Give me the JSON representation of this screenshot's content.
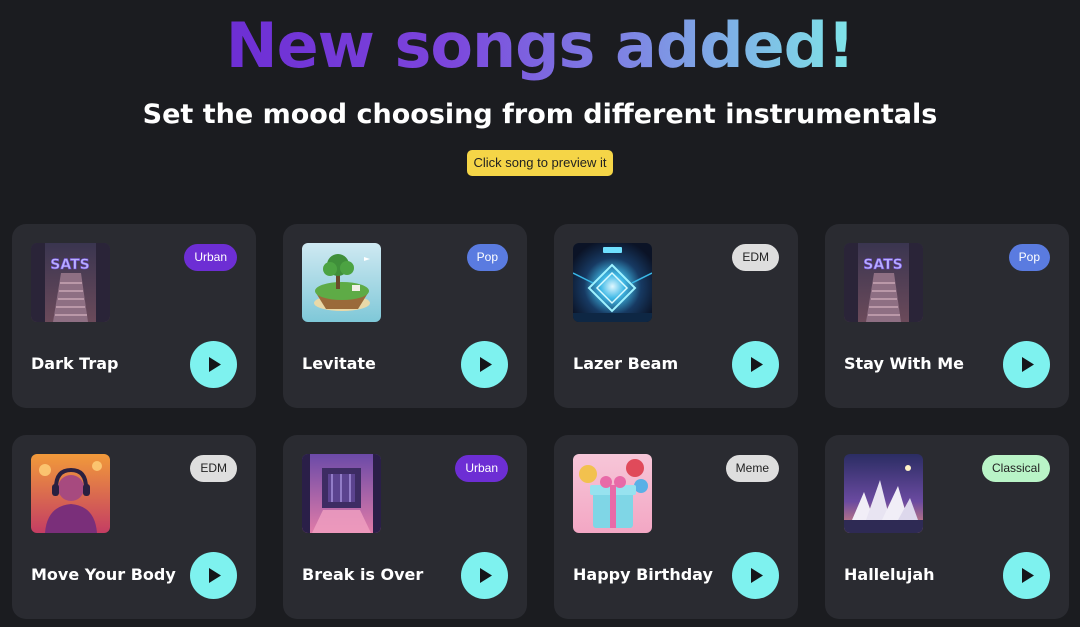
{
  "header": {
    "headline": "New songs added!",
    "subtitle": "Set the mood choosing from different instrumentals",
    "hint": "Click song to preview it"
  },
  "colors": {
    "background": "#1b1c20",
    "card": "#2a2b31",
    "play_button": "#7ef2ef",
    "hint": "#f5d547",
    "headline_gradient": [
      "#6d2ed4",
      "#7e87e4",
      "#7fe6e8"
    ]
  },
  "songs": [
    {
      "title": "Dark Trap",
      "genre": "Urban",
      "genre_color": "#6d2ed4",
      "genre_text": "#ffffff",
      "art": "graffiti-stairs-art"
    },
    {
      "title": "Levitate",
      "genre": "Pop",
      "genre_color": "#5a7be0",
      "genre_text": "#ffffff",
      "art": "floating-island-art"
    },
    {
      "title": "Lazer Beam",
      "genre": "EDM",
      "genre_color": "#dedede",
      "genre_text": "#222222",
      "art": "neon-tunnel-art"
    },
    {
      "title": "Stay With Me",
      "genre": "Pop",
      "genre_color": "#5a7be0",
      "genre_text": "#ffffff",
      "art": "graffiti-stairs-art"
    },
    {
      "title": "Move Your Body",
      "genre": "EDM",
      "genre_color": "#dedede",
      "genre_text": "#222222",
      "art": "headphones-person-art"
    },
    {
      "title": "Break is Over",
      "genre": "Urban",
      "genre_color": "#6d2ed4",
      "genre_text": "#ffffff",
      "art": "neon-stage-art"
    },
    {
      "title": "Happy Birthday",
      "genre": "Meme",
      "genre_color": "#dedede",
      "genre_text": "#222222",
      "art": "gift-balloons-art"
    },
    {
      "title": "Hallelujah",
      "genre": "Classical",
      "genre_color": "#b9f4c7",
      "genre_text": "#222222",
      "art": "opera-house-art"
    }
  ]
}
